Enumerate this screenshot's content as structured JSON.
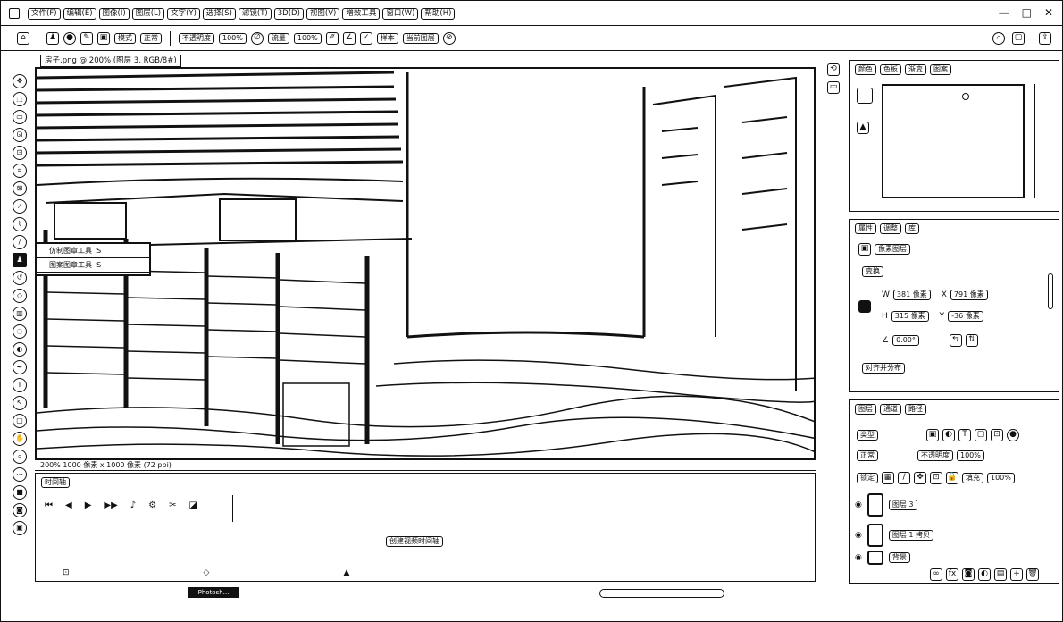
{
  "menubar": {
    "items": [
      "文件(F)",
      "编辑(E)",
      "图像(I)",
      "图层(L)",
      "文字(Y)",
      "选择(S)",
      "滤镜(T)",
      "3D(D)",
      "视图(V)",
      "增效工具",
      "窗口(W)",
      "帮助(H)"
    ],
    "window_controls": [
      "—",
      "□",
      "✕"
    ]
  },
  "optionsbar": {
    "mode_label": "模式",
    "mode_value": "正常",
    "opacity_label": "不透明度",
    "opacity_value": "100%",
    "flow_label": "流量",
    "flow_value": "100%",
    "sample_label": "样本",
    "sample_value": "当前图层"
  },
  "document": {
    "tab_title": "房子.png @ 200% (图层 3, RGB/8#)",
    "status": "200%   1000 像素 x 1000 像素 (72 ppi)"
  },
  "tool_flyout": {
    "items": [
      "仿制图章工具",
      "图案图章工具"
    ],
    "shortcuts": [
      "S",
      "S"
    ]
  },
  "timeline": {
    "tab": "时间轴",
    "create_button": "创建视频时间轴"
  },
  "navigator": {
    "tabs": [
      "颜色",
      "色板",
      "渐变",
      "图案"
    ]
  },
  "properties": {
    "tabs": [
      "属性",
      "调整",
      "库"
    ],
    "layer_type": "像素图层",
    "section_transform": "变换",
    "w_label": "W",
    "w_value": "381 像素",
    "x_label": "X",
    "x_value": "791 像素",
    "h_label": "H",
    "h_value": "315 像素",
    "y_value": "-36 像素",
    "angle_value": "0.00°",
    "align_button": "对齐并分布"
  },
  "layers": {
    "tabs": [
      "图层",
      "通道",
      "路径"
    ],
    "filter_kind": "类型",
    "blend_mode": "正常",
    "opacity_label": "不透明度",
    "opacity_value": "100%",
    "lock_label": "锁定",
    "fill_label": "填充",
    "fill_value": "100%",
    "items": [
      {
        "name": "图层 3"
      },
      {
        "name": "图层 1 拷贝"
      },
      {
        "name": "背景"
      }
    ]
  },
  "taskbar": {
    "app_label": "Photosh..."
  }
}
